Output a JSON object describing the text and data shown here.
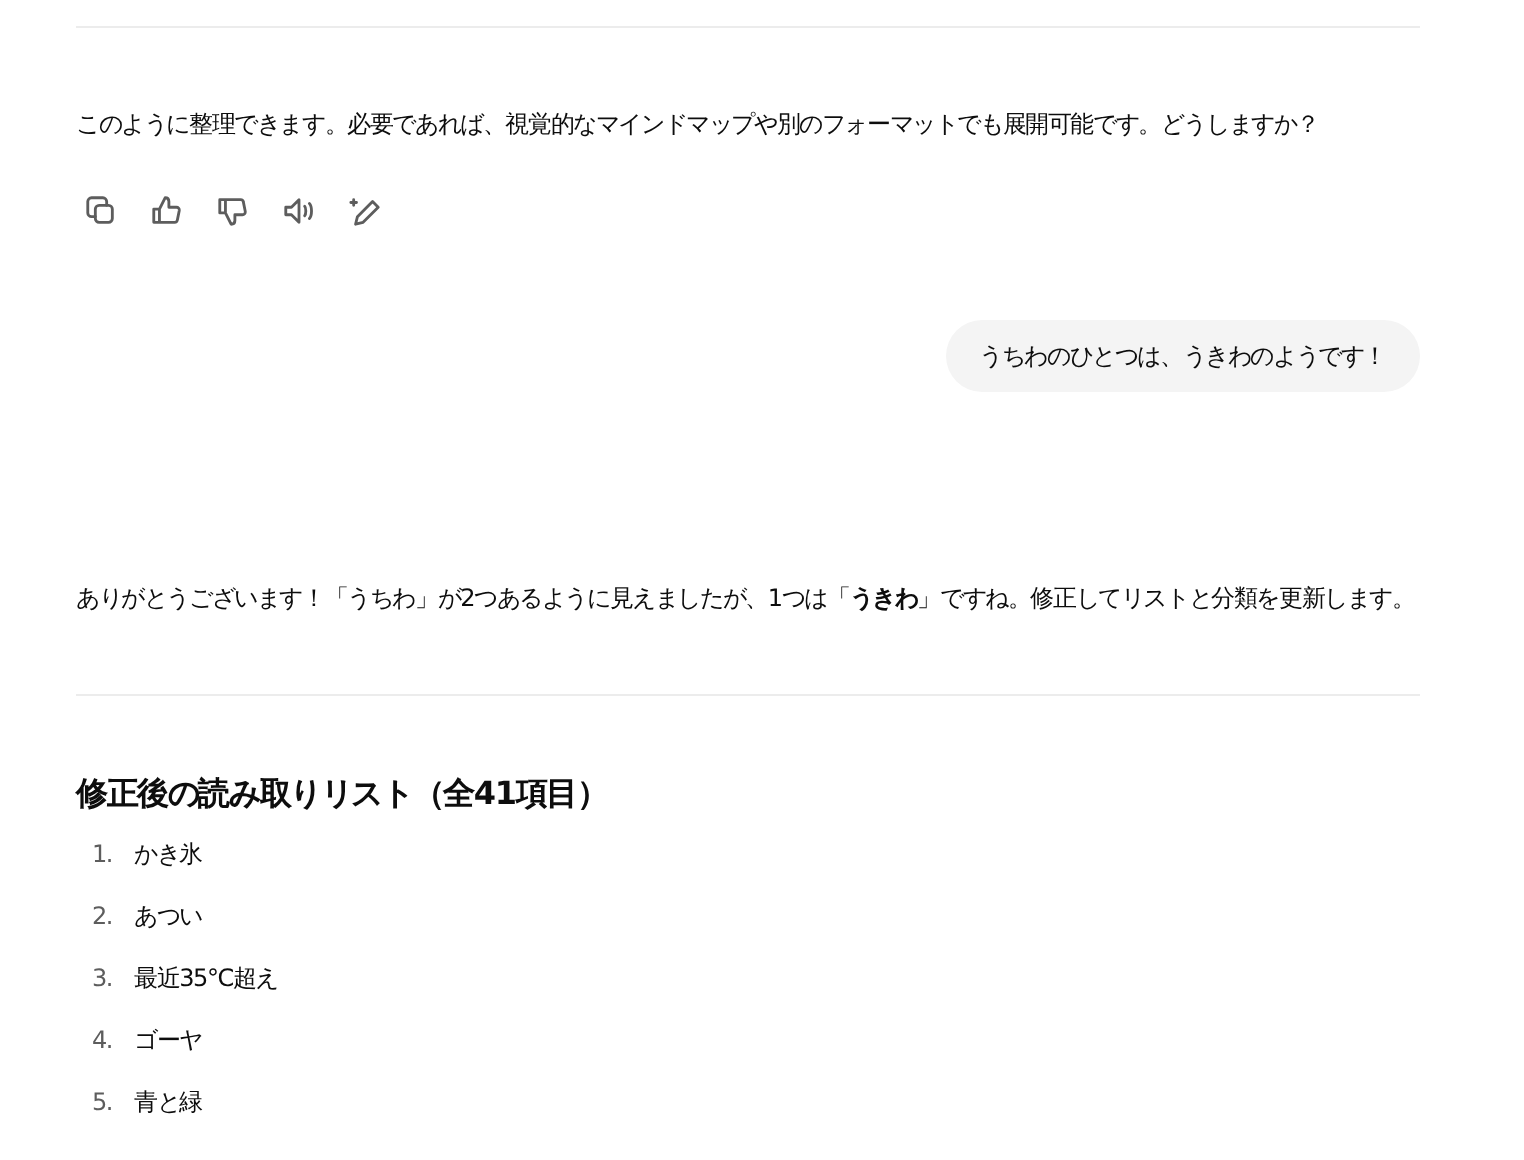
{
  "assistant_message_1": {
    "text": "このように整理できます。必要であれば、視覚的なマインドマップや別のフォーマットでも展開可能です。どうしますか？",
    "actions": [
      {
        "kind": "copy"
      },
      {
        "kind": "thumbs_up"
      },
      {
        "kind": "thumbs_down"
      },
      {
        "kind": "speaker"
      },
      {
        "kind": "edit"
      }
    ]
  },
  "user_message": {
    "text": "うちわのひとつは、うきわのようです！"
  },
  "assistant_message_2": {
    "text": "ありがとうございます！「うちわ」が2つあるように見えましたが、1つは「**うきわ**」ですね。修正してリストと分類を更新します。",
    "heading": "修正後の読み取りリスト（全41項目）",
    "list": [
      {
        "number": "1.",
        "text": "かき氷"
      },
      {
        "number": "2.",
        "text": "あつい"
      },
      {
        "number": "3.",
        "text": "最近35°C超え"
      },
      {
        "number": "4.",
        "text": "ゴーヤ"
      },
      {
        "number": "5.",
        "text": "青と緑"
      }
    ]
  }
}
